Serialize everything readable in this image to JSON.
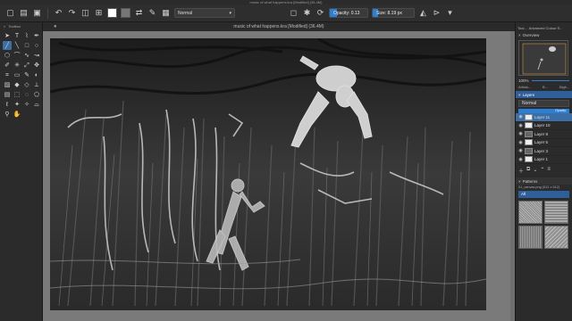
{
  "window": {
    "title": "music of what happens.kra [Modified]  (36.4M)"
  },
  "toolbar": {
    "blend_mode": "Normal",
    "opacity_label": "Opacity: 0.13",
    "opacity_value": 0.13,
    "size_label": "Size: 8.19 px",
    "size_value": 8.19
  },
  "toolbox": {
    "title": "Toolbox"
  },
  "document": {
    "tab_title": "music of what happens.kra [Modified]  (36.4M)"
  },
  "dock": {
    "tab_a": "Tool...",
    "tab_b": "Advanced Colour S...",
    "overview_title": "Overview",
    "zoom": "100%",
    "subtabs": [
      "Artists...",
      "B...",
      "Digit..."
    ],
    "layers_title": "Layers",
    "blend_mode": "Normal",
    "opacity_text": "Opacity:",
    "layers": [
      {
        "name": "Layer 11",
        "selected": true,
        "thumb": "light"
      },
      {
        "name": "Layer 10",
        "selected": false,
        "thumb": "light"
      },
      {
        "name": "Layer 9",
        "selected": false,
        "thumb": "dark"
      },
      {
        "name": "Layer 5",
        "selected": false,
        "thumb": "light"
      },
      {
        "name": "Layer 3",
        "selected": false,
        "thumb": "dark"
      },
      {
        "name": "Layer 1",
        "selected": false,
        "thumb": "light"
      }
    ],
    "patterns_title": "Patterns",
    "pattern_file": "01_canvas.png (512 x 512)",
    "pattern_filter": "All"
  },
  "colors": {
    "accent": "#2b7fd4",
    "selection": "#3b6ea5",
    "panel": "#2b2b2b",
    "canvas_bg": "#7a7a7a"
  }
}
